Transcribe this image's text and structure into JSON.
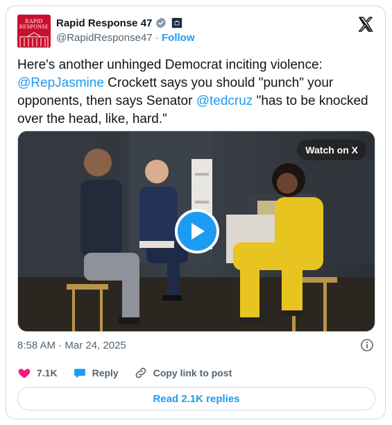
{
  "author": {
    "name": "Rapid Response 47",
    "handle": "@RapidResponse47",
    "separator": "·",
    "follow_label": "Follow",
    "avatar_text_line1": "RAPID",
    "avatar_text_line2": "RESPONSE",
    "verified_color": "#829aab"
  },
  "tweet": {
    "text_part1": "Here's another unhinged Democrat inciting violence: ",
    "mention1": "@RepJasmine",
    "text_part2": " Crockett says you should \"punch\" your opponents, then says Senator ",
    "mention2": "@tedcruz",
    "text_part3": " \"has to be knocked over the head, like, hard.\""
  },
  "media": {
    "watch_label": "Watch on X",
    "play_icon": "play-icon"
  },
  "timestamp": "8:58 AM · Mar 24, 2025",
  "actions": {
    "like_count": "7.1K",
    "reply_label": "Reply",
    "copy_label": "Copy link to post"
  },
  "read_replies_label": "Read 2.1K replies",
  "colors": {
    "accent": "#1d9bf0",
    "like": "#f91880",
    "muted": "#536471",
    "brand_red": "#c8102e"
  }
}
